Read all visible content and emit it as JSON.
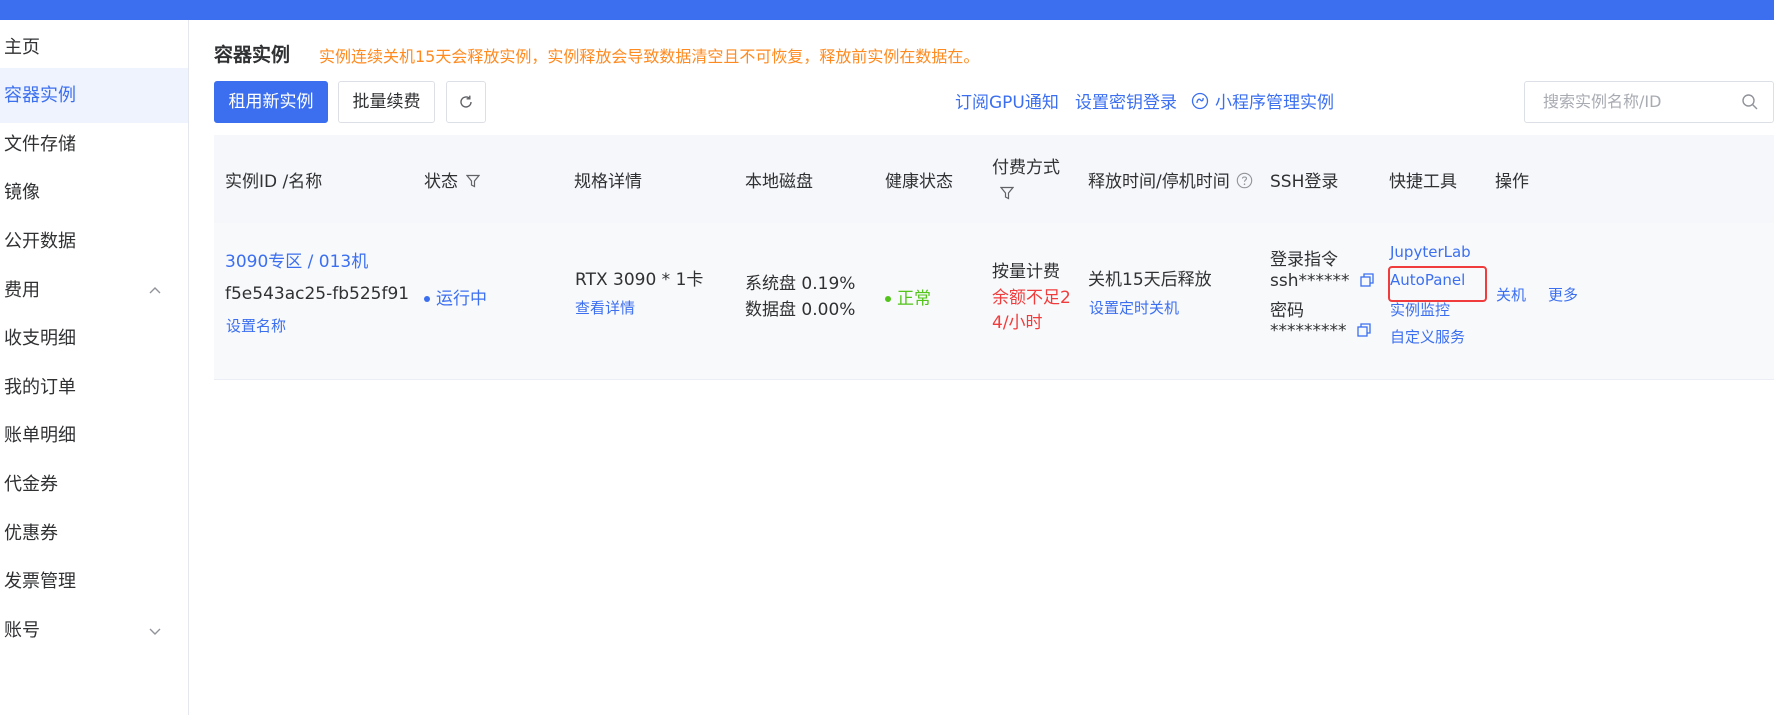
{
  "colors": {
    "brand": "#3b6ff0",
    "warning": "#ff8a1f",
    "danger": "#f03c3c",
    "success": "#52c41a"
  },
  "sidebar": {
    "items": [
      {
        "label": "主页"
      },
      {
        "label": "容器实例",
        "active": true
      },
      {
        "label": "文件存储"
      },
      {
        "label": "镜像"
      },
      {
        "label": "公开数据"
      },
      {
        "label": "费用",
        "expanded": true
      },
      {
        "label": "收支明细"
      },
      {
        "label": "我的订单"
      },
      {
        "label": "账单明细"
      },
      {
        "label": "代金券"
      },
      {
        "label": "优惠券"
      },
      {
        "label": "发票管理"
      },
      {
        "label": "账号",
        "expanded": false
      }
    ]
  },
  "header": {
    "title": "容器实例",
    "notice": "实例连续关机15天会释放实例，实例释放会导致数据清空且不可恢复，释放前实例在数据在。"
  },
  "toolbar": {
    "rent_label": "租用新实例",
    "batch_renew_label": "批量续费",
    "refresh_icon": "refresh-icon",
    "subscribe_gpu_label": "订阅GPU通知",
    "set_key_label": "设置密钥登录",
    "mini_program_label": "小程序管理实例",
    "search_placeholder": "搜索实例名称/ID"
  },
  "table": {
    "columns": {
      "id_name": "实例ID /名称",
      "status": "状态",
      "spec": "规格详情",
      "disk": "本地磁盘",
      "health": "健康状态",
      "billing": "付费方式",
      "release": "释放时间/停机时间",
      "ssh": "SSH登录",
      "tools": "快捷工具",
      "actions": "操作"
    },
    "rows": [
      {
        "name": "3090专区 / 013机",
        "id": "f5e543ac25-fb525f91",
        "set_name": "设置名称",
        "status": "运行中",
        "spec": "RTX 3090 * 1卡",
        "spec_detail": "查看详情",
        "system_disk": "系统盘 0.19%",
        "data_disk": "数据盘 0.00%",
        "health": "正常",
        "billing": "按量计费",
        "billing_warn_1": "余额不足2",
        "billing_warn_2": "4/小时",
        "release": "关机15天后释放",
        "set_timer": "设置定时关机",
        "ssh_cmd_label": "登录指令",
        "ssh_cmd": "ssh******",
        "password_label": "密码",
        "password": "*********",
        "tool_jupyter": "JupyterLab",
        "tool_autopanel": "AutoPanel",
        "tool_monitor": "实例监控",
        "tool_custom": "自定义服务",
        "action_shutdown": "关机",
        "action_more": "更多"
      }
    ]
  }
}
